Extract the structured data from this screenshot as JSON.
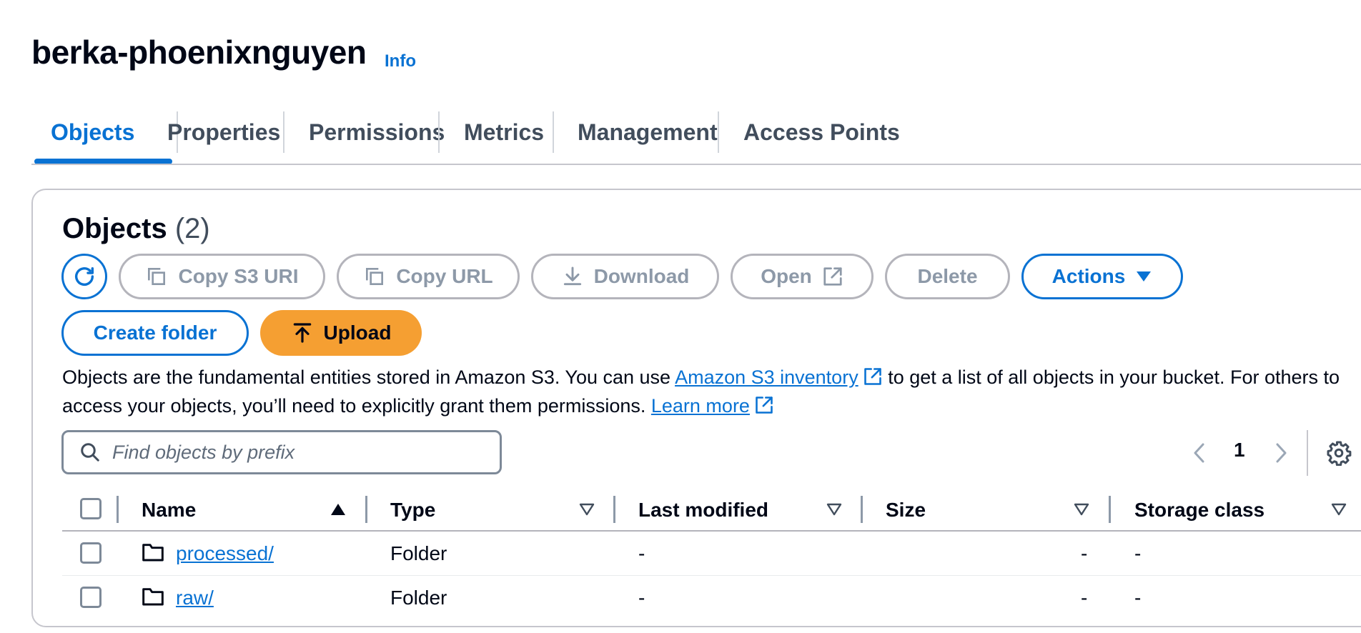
{
  "header": {
    "title": "berka-phoenixnguyen",
    "info_label": "Info"
  },
  "tabs": [
    {
      "label": "Objects",
      "active": true
    },
    {
      "label": "Properties"
    },
    {
      "label": "Permissions"
    },
    {
      "label": "Metrics"
    },
    {
      "label": "Management"
    },
    {
      "label": "Access Points"
    }
  ],
  "objects_panel": {
    "heading": "Objects",
    "count": "(2)",
    "toolbar": {
      "refresh_icon": "refresh-icon",
      "copy_s3_uri": "Copy S3 URI",
      "copy_url": "Copy URL",
      "download": "Download",
      "open": "Open",
      "delete": "Delete",
      "actions": "Actions",
      "create_folder": "Create folder",
      "upload": "Upload"
    },
    "description": {
      "part1": "Objects are the fundamental entities stored in Amazon S3. You can use ",
      "link1": "Amazon S3 inventory",
      "part2": " to get a list of all objects in your bucket. For others to access your objects, you’ll need to explicitly grant them permissions. ",
      "link2": "Learn more"
    },
    "search": {
      "placeholder": "Find objects by prefix",
      "value": ""
    },
    "pagination": {
      "current_page": "1"
    },
    "table": {
      "columns": [
        "Name",
        "Type",
        "Last modified",
        "Size",
        "Storage class"
      ],
      "rows": [
        {
          "name": "processed/",
          "type": "Folder",
          "last_modified": "-",
          "size": "-",
          "storage_class": "-"
        },
        {
          "name": "raw/",
          "type": "Folder",
          "last_modified": "-",
          "size": "-",
          "storage_class": "-"
        }
      ]
    }
  },
  "colors": {
    "accent": "#0972d3",
    "primary_button": "#f59f32",
    "disabled_text": "#8d99a8",
    "text": "#000716"
  }
}
